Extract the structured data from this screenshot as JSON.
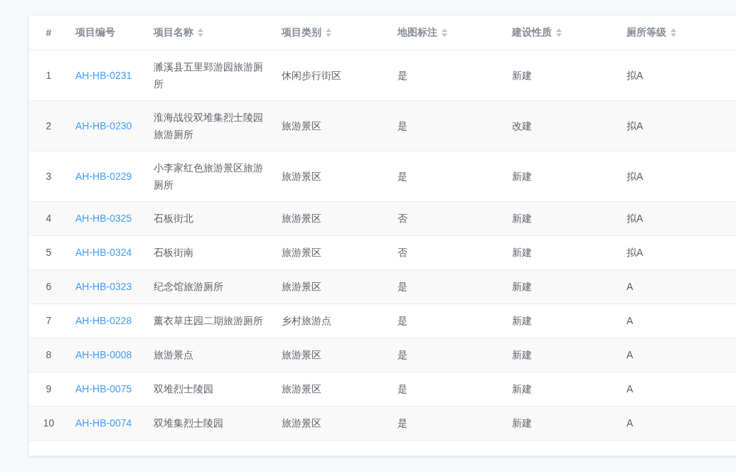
{
  "table": {
    "columns": [
      {
        "label": "#",
        "sortable": false
      },
      {
        "label": "项目编号",
        "sortable": false
      },
      {
        "label": "项目名称",
        "sortable": true
      },
      {
        "label": "项目类别",
        "sortable": true
      },
      {
        "label": "地图标注",
        "sortable": true
      },
      {
        "label": "建设性质",
        "sortable": true
      },
      {
        "label": "厕所等级",
        "sortable": true
      }
    ],
    "rows": [
      {
        "index": "1",
        "code": "AH-HB-0231",
        "name": "濉溪县五里郢游园旅游厕所",
        "category": "休闲步行街区",
        "map_marked": "是",
        "construction": "新建",
        "grade": "拟A"
      },
      {
        "index": "2",
        "code": "AH-HB-0230",
        "name": "淮海战役双堆集烈士陵园旅游厕所",
        "category": "旅游景区",
        "map_marked": "是",
        "construction": "改建",
        "grade": "拟A"
      },
      {
        "index": "3",
        "code": "AH-HB-0229",
        "name": "小李家红色旅游景区旅游厕所",
        "category": "旅游景区",
        "map_marked": "是",
        "construction": "新建",
        "grade": "拟A"
      },
      {
        "index": "4",
        "code": "AH-HB-0325",
        "name": "石板街北",
        "category": "旅游景区",
        "map_marked": "否",
        "construction": "新建",
        "grade": "拟A"
      },
      {
        "index": "5",
        "code": "AH-HB-0324",
        "name": "石板街南",
        "category": "旅游景区",
        "map_marked": "否",
        "construction": "新建",
        "grade": "拟A"
      },
      {
        "index": "6",
        "code": "AH-HB-0323",
        "name": "纪念馆旅游厕所",
        "category": "旅游景区",
        "map_marked": "是",
        "construction": "新建",
        "grade": "A"
      },
      {
        "index": "7",
        "code": "AH-HB-0228",
        "name": "薰衣草庄园二期旅游厕所",
        "category": "乡村旅游点",
        "map_marked": "是",
        "construction": "新建",
        "grade": "A"
      },
      {
        "index": "8",
        "code": "AH-HB-0008",
        "name": "旅游景点",
        "category": "旅游景区",
        "map_marked": "是",
        "construction": "新建",
        "grade": "A"
      },
      {
        "index": "9",
        "code": "AH-HB-0075",
        "name": "双堆烈士陵园",
        "category": "旅游景区",
        "map_marked": "是",
        "construction": "新建",
        "grade": "A"
      },
      {
        "index": "10",
        "code": "AH-HB-0074",
        "name": "双堆集烈士陵园",
        "category": "旅游景区",
        "map_marked": "是",
        "construction": "新建",
        "grade": "A"
      }
    ]
  }
}
